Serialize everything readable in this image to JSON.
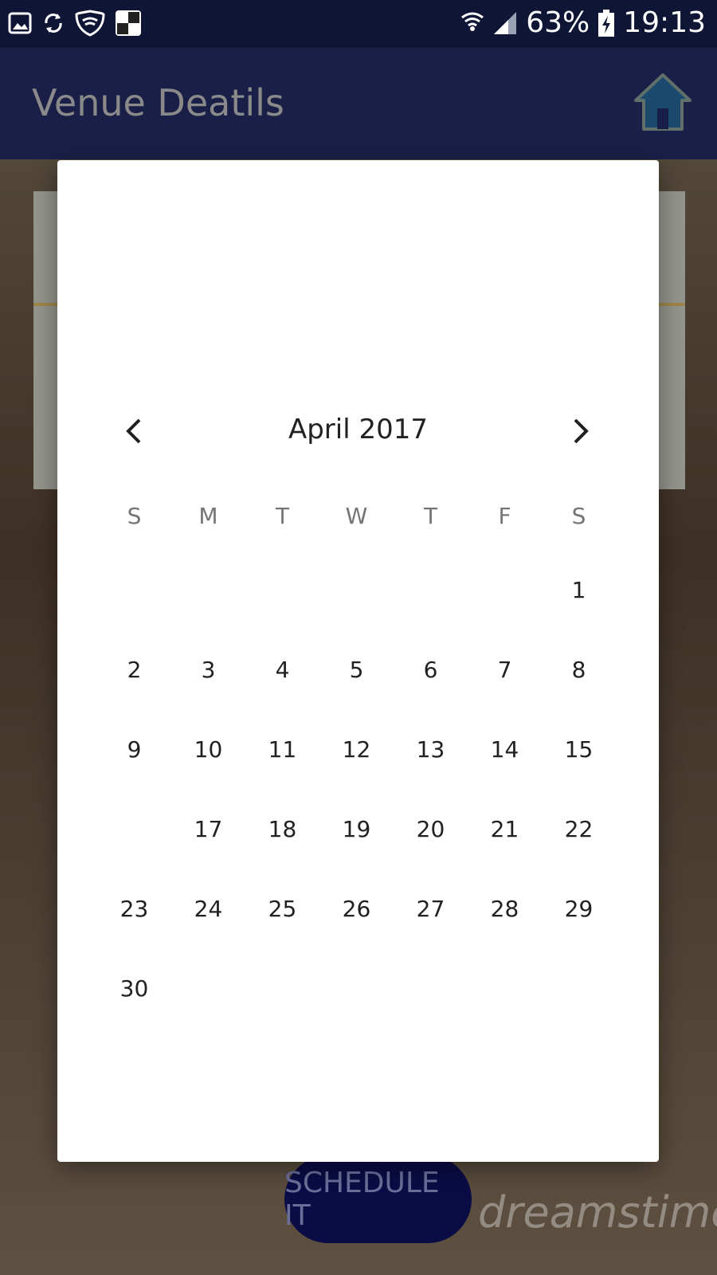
{
  "status_bar": {
    "battery": "63%",
    "time": "19:13"
  },
  "app_bar": {
    "title": "Venue Deatils"
  },
  "calendar": {
    "month_label": "April 2017",
    "weekdays": [
      "S",
      "M",
      "T",
      "W",
      "T",
      "F",
      "S"
    ],
    "weeks": [
      [
        "",
        "",
        "",
        "",
        "",
        "",
        "1"
      ],
      [
        "2",
        "3",
        "4",
        "5",
        "6",
        "7",
        "8"
      ],
      [
        "9",
        "10",
        "11",
        "12",
        "13",
        "14",
        "15"
      ],
      [
        "",
        "17",
        "18",
        "19",
        "20",
        "21",
        "22"
      ],
      [
        "23",
        "24",
        "25",
        "26",
        "27",
        "28",
        "29"
      ],
      [
        "30",
        "",
        "",
        "",
        "",
        "",
        ""
      ]
    ]
  },
  "background": {
    "schedule_button": "SCHEDULE IT"
  },
  "colors": {
    "status_bar": "#0f1535",
    "app_bar": "#1a1f47",
    "button": "#0b0c45"
  }
}
